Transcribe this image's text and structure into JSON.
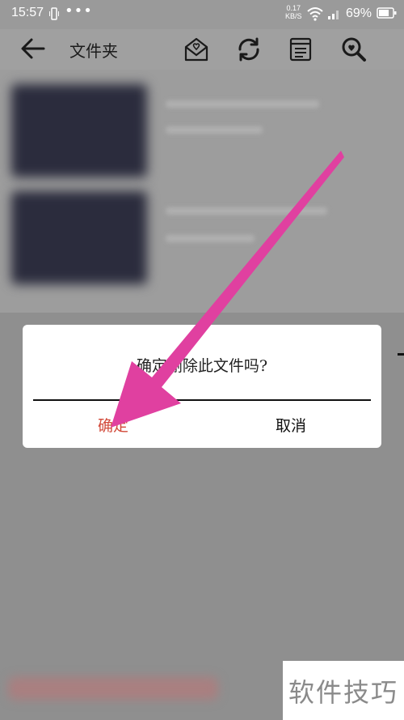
{
  "status_bar": {
    "time": "15:57",
    "more": "•••",
    "net_speed_value": "0.17",
    "net_speed_unit": "KB/S",
    "battery": "69%"
  },
  "toolbar": {
    "title": "文件夹",
    "icons": [
      "back-arrow-icon",
      "mail-icon",
      "refresh-icon",
      "list-icon",
      "search-icon"
    ]
  },
  "dialog": {
    "message": "确定删除此文件吗?",
    "confirm_label": "确定",
    "cancel_label": "取消"
  },
  "watermark": "软件技巧",
  "colors": {
    "confirm": "#d24a3a",
    "arrow": "#e040a0",
    "overlay": "#8f8f8f"
  }
}
